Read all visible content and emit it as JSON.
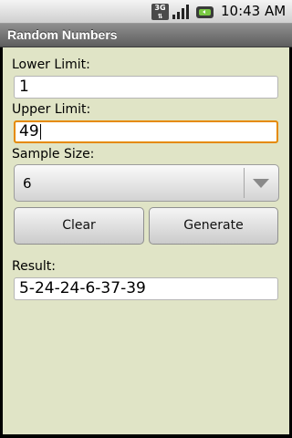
{
  "status_bar": {
    "network": "3G",
    "time": "10:43 AM",
    "icons": [
      "3g-data-icon",
      "signal-icon",
      "battery-icon"
    ]
  },
  "title_bar": {
    "title": "Random Numbers"
  },
  "form": {
    "lower_limit": {
      "label": "Lower Limit:",
      "value": "1"
    },
    "upper_limit": {
      "label": "Upper Limit:",
      "value": "49"
    },
    "sample_size": {
      "label": "Sample Size:",
      "value": "6"
    },
    "buttons": {
      "clear": "Clear",
      "generate": "Generate"
    },
    "result": {
      "label": "Result:",
      "value": "5-24-24-6-37-39"
    }
  },
  "colors": {
    "background": "#e0e4c6",
    "focus_border": "#e58a00",
    "titlebar": "#707070"
  }
}
